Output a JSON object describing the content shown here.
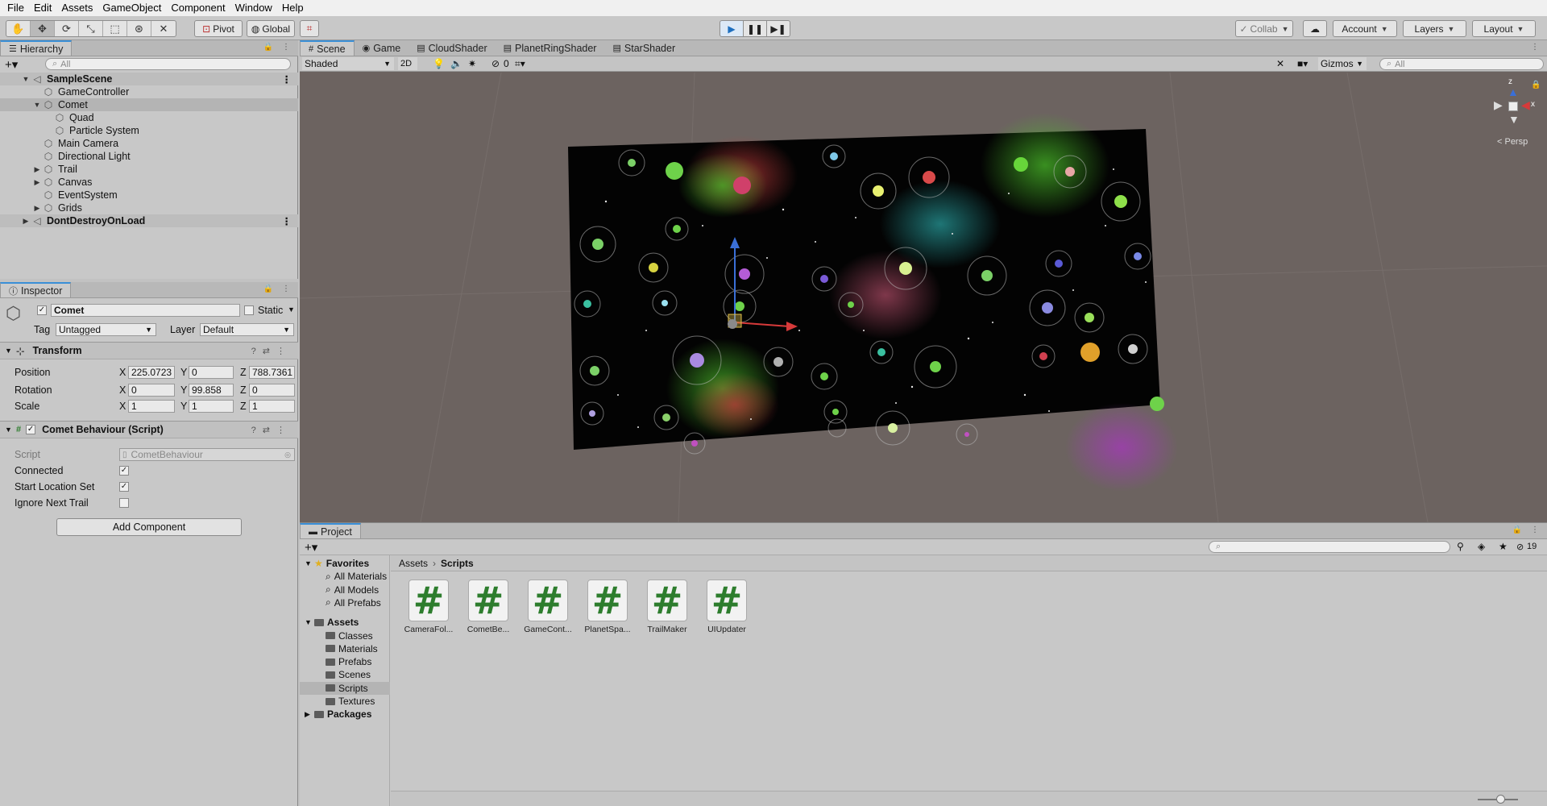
{
  "menu": [
    "File",
    "Edit",
    "Assets",
    "GameObject",
    "Component",
    "Window",
    "Help"
  ],
  "toolbar": {
    "pivot": "Pivot",
    "global": "Global",
    "collab": "Collab",
    "account": "Account",
    "layers": "Layers",
    "layout": "Layout"
  },
  "hierarchy": {
    "tab": "Hierarchy",
    "search_placeholder": "All",
    "items": [
      {
        "label": "SampleScene",
        "depth": 0,
        "arrow": "▼",
        "kind": "scene"
      },
      {
        "label": "GameController",
        "depth": 1,
        "arrow": "",
        "kind": "obj"
      },
      {
        "label": "Comet",
        "depth": 1,
        "arrow": "▼",
        "kind": "sel"
      },
      {
        "label": "Quad",
        "depth": 2,
        "arrow": "",
        "kind": "obj"
      },
      {
        "label": "Particle System",
        "depth": 2,
        "arrow": "",
        "kind": "obj"
      },
      {
        "label": "Main Camera",
        "depth": 1,
        "arrow": "",
        "kind": "obj"
      },
      {
        "label": "Directional Light",
        "depth": 1,
        "arrow": "",
        "kind": "obj"
      },
      {
        "label": "Trail",
        "depth": 1,
        "arrow": "▶",
        "kind": "obj"
      },
      {
        "label": "Canvas",
        "depth": 1,
        "arrow": "▶",
        "kind": "obj"
      },
      {
        "label": "EventSystem",
        "depth": 1,
        "arrow": "",
        "kind": "obj"
      },
      {
        "label": "Grids",
        "depth": 1,
        "arrow": "▶",
        "kind": "obj"
      },
      {
        "label": "DontDestroyOnLoad",
        "depth": 0,
        "arrow": "▶",
        "kind": "scene2"
      }
    ]
  },
  "inspector": {
    "tab": "Inspector",
    "object_name": "Comet",
    "static_label": "Static",
    "tag_label": "Tag",
    "tag_value": "Untagged",
    "layer_label": "Layer",
    "layer_value": "Default",
    "transform": {
      "title": "Transform",
      "position_label": "Position",
      "rotation_label": "Rotation",
      "scale_label": "Scale",
      "position": {
        "x": "225.0723",
        "y": "0",
        "z": "788.7361"
      },
      "rotation": {
        "x": "0",
        "y": "99.858",
        "z": "0"
      },
      "scale": {
        "x": "1",
        "y": "1",
        "z": "1"
      }
    },
    "script_component": {
      "title": "Comet Behaviour (Script)",
      "script_label": "Script",
      "script_value": "CometBehaviour",
      "connected_label": "Connected",
      "start_location_label": "Start Location Set",
      "ignore_trail_label": "Ignore Next Trail",
      "connected": true,
      "start_location_set": true,
      "ignore_next_trail": false
    },
    "add_component": "Add Component"
  },
  "scene": {
    "tabs": [
      "Scene",
      "Game",
      "CloudShader",
      "PlanetRingShader",
      "StarShader"
    ],
    "shading": "Shaded",
    "mode_2d": "2D",
    "hidden_count": "0",
    "gizmos": "Gizmos",
    "search_placeholder": "All",
    "persp": "< Persp"
  },
  "project": {
    "tab": "Project",
    "breadcrumb": [
      "Assets",
      "Scripts"
    ],
    "count_badge": "19",
    "favorites_label": "Favorites",
    "favorites": [
      "All Materials",
      "All Models",
      "All Prefabs"
    ],
    "assets_label": "Assets",
    "folders": [
      "Classes",
      "Materials",
      "Prefabs",
      "Scenes",
      "Scripts",
      "Textures"
    ],
    "packages_label": "Packages",
    "files": [
      "CameraFol...",
      "CometBe...",
      "GameCont...",
      "PlanetSpa...",
      "TrailMaker",
      "UIUpdater"
    ]
  }
}
